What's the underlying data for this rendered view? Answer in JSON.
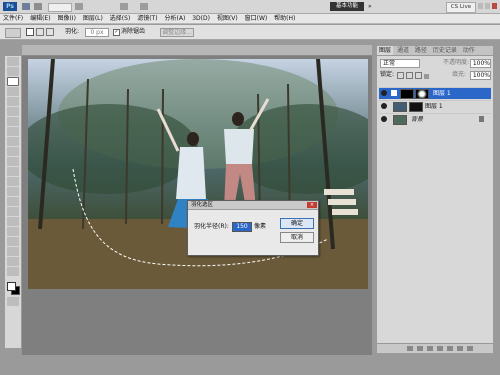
{
  "titlebar": {
    "logo": "Ps",
    "layout_selector": "基本功能",
    "cslive": "CS Live"
  },
  "menu": [
    "文件(F)",
    "编辑(E)",
    "图像(I)",
    "图层(L)",
    "选择(S)",
    "滤镜(T)",
    "分析(A)",
    "3D(D)",
    "视图(V)",
    "窗口(W)",
    "帮助(H)"
  ],
  "options": {
    "feather_label": "羽化:",
    "feather_value": "0 px",
    "antialias_label": "消除锯齿",
    "refine_label": "调整边缘..."
  },
  "layers_panel": {
    "tabs": [
      "图层",
      "通道",
      "路径",
      "历史记录",
      "动作"
    ],
    "blend_mode": "正常",
    "opacity_label": "不透明度:",
    "opacity_value": "100%",
    "lock_label": "锁定:",
    "fill_label": "填充:",
    "fill_value": "100%",
    "layers": [
      {
        "name": "图层 1",
        "selected": true
      },
      {
        "name": "图层 1",
        "selected": false
      },
      {
        "name": "背景",
        "selected": false
      }
    ]
  },
  "dialog": {
    "title": "羽化选区",
    "feather_radius_label": "羽化半径(R):",
    "feather_radius_value": "150",
    "unit": "像素",
    "ok_label": "确定",
    "cancel_label": "取消"
  },
  "colors": {
    "selection_blue": "#2b67c8",
    "panel_bg": "#d8d8d8"
  }
}
